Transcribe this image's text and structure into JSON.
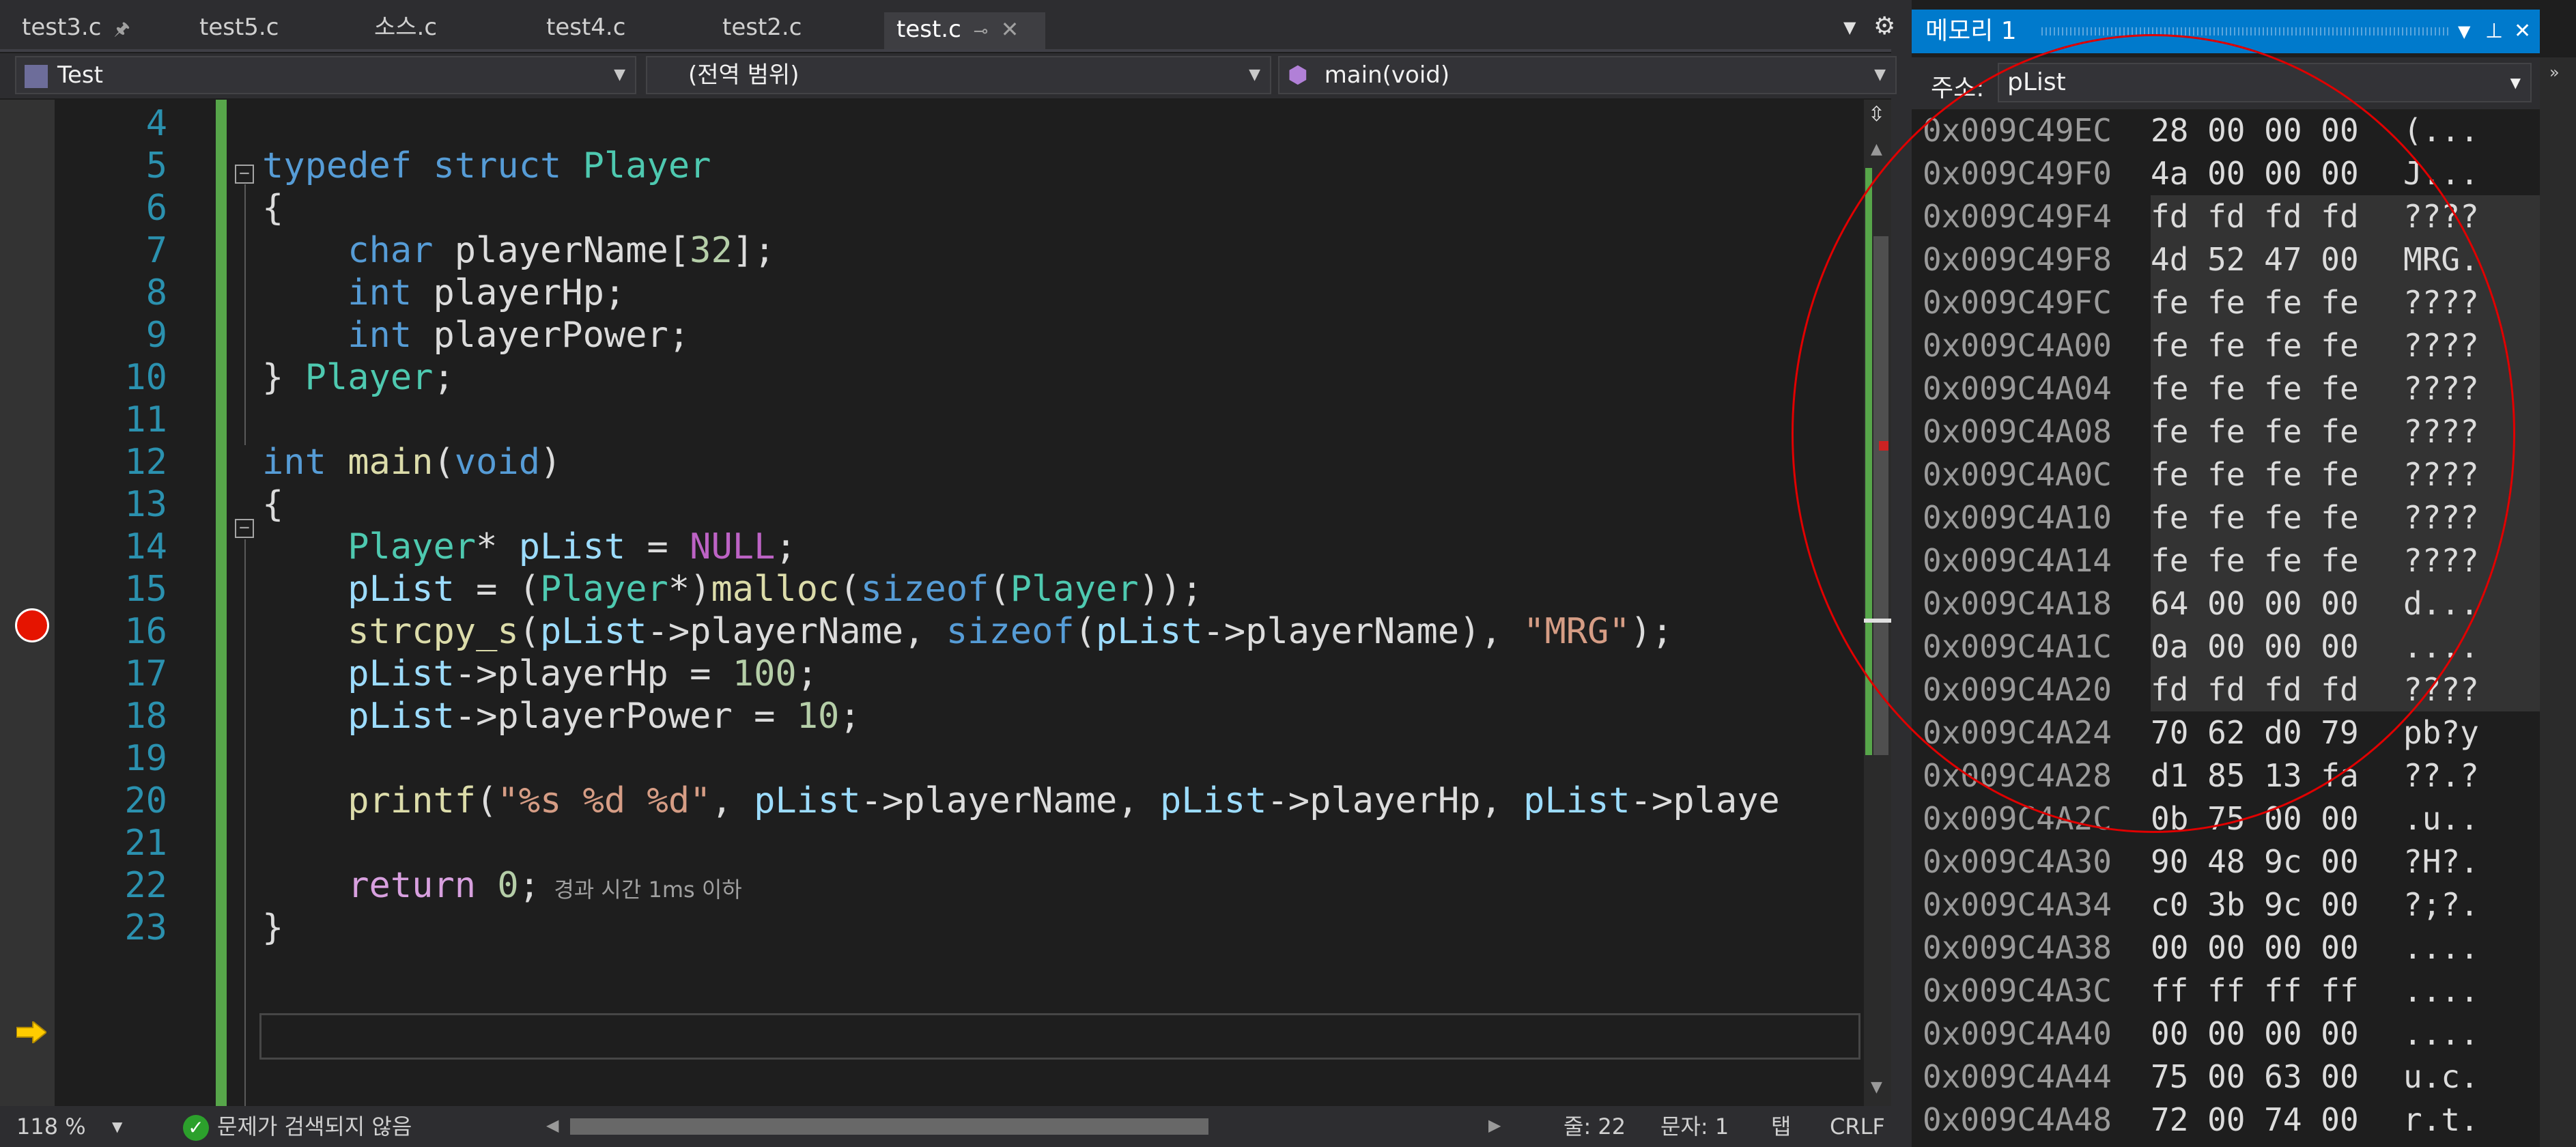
{
  "tabs": [
    {
      "label": "test3.c",
      "pin": "🖈"
    },
    {
      "label": "test5.c"
    },
    {
      "label": "소스.c"
    },
    {
      "label": "test4.c"
    },
    {
      "label": "test2.c"
    },
    {
      "label": "test.c",
      "active": true
    }
  ],
  "nav": {
    "project": "Test",
    "scope": "(전역 범위)",
    "function": "main(void)"
  },
  "code_lines": [
    {
      "num": "4",
      "text": ""
    },
    {
      "num": "5",
      "text": "typedef struct Player"
    },
    {
      "num": "6",
      "text": "{"
    },
    {
      "num": "7",
      "text": "    char playerName[32];"
    },
    {
      "num": "8",
      "text": "    int playerHp;"
    },
    {
      "num": "9",
      "text": "    int playerPower;"
    },
    {
      "num": "10",
      "text": "} Player;"
    },
    {
      "num": "11",
      "text": ""
    },
    {
      "num": "12",
      "text": "int main(void)"
    },
    {
      "num": "13",
      "text": "{"
    },
    {
      "num": "14",
      "text": "    Player* pList = NULL;"
    },
    {
      "num": "15",
      "text": "    pList = (Player*)malloc(sizeof(Player));"
    },
    {
      "num": "16",
      "text": "    strcpy_s(pList->playerName, sizeof(pList->playerName), \"MRG\");"
    },
    {
      "num": "17",
      "text": "    pList->playerHp = 100;"
    },
    {
      "num": "18",
      "text": "    pList->playerPower = 10;"
    },
    {
      "num": "19",
      "text": ""
    },
    {
      "num": "20",
      "text": "    printf(\"%s %d %d\", pList->playerName, pList->playerHp, pList->playe"
    },
    {
      "num": "21",
      "text": ""
    },
    {
      "num": "22",
      "text": "    return 0;"
    },
    {
      "num": "23",
      "text": "}"
    }
  ],
  "elapsed_hint": "경과 시간 1ms 이하",
  "status": {
    "zoom": "118 %",
    "issues": "문제가 검색되지 않음",
    "line": "줄: 22",
    "col": "문자: 1",
    "tab": "탭",
    "eol": "CRLF"
  },
  "memory": {
    "title": "메모리 1",
    "address_label": "주소:",
    "address_value": "pList",
    "rows": [
      {
        "addr": "0x009C49EC",
        "hex": "28 00 00 00",
        "text": "(..."
      },
      {
        "addr": "0x009C49F0",
        "hex": "4a 00 00 00",
        "text": "J..."
      },
      {
        "addr": "0x009C49F4",
        "hex": "fd fd fd fd",
        "text": "????",
        "hl": true
      },
      {
        "addr": "0x009C49F8",
        "hex": "4d 52 47 00",
        "text": "MRG.",
        "hl": true
      },
      {
        "addr": "0x009C49FC",
        "hex": "fe fe fe fe",
        "text": "????",
        "hl": true
      },
      {
        "addr": "0x009C4A00",
        "hex": "fe fe fe fe",
        "text": "????",
        "hl": true
      },
      {
        "addr": "0x009C4A04",
        "hex": "fe fe fe fe",
        "text": "????",
        "hl": true
      },
      {
        "addr": "0x009C4A08",
        "hex": "fe fe fe fe",
        "text": "????",
        "hl": true
      },
      {
        "addr": "0x009C4A0C",
        "hex": "fe fe fe fe",
        "text": "????",
        "hl": true
      },
      {
        "addr": "0x009C4A10",
        "hex": "fe fe fe fe",
        "text": "????",
        "hl": true
      },
      {
        "addr": "0x009C4A14",
        "hex": "fe fe fe fe",
        "text": "????",
        "hl": true
      },
      {
        "addr": "0x009C4A18",
        "hex": "64 00 00 00",
        "text": "d...",
        "hl": true
      },
      {
        "addr": "0x009C4A1C",
        "hex": "0a 00 00 00",
        "text": "....",
        "hl": true
      },
      {
        "addr": "0x009C4A20",
        "hex": "fd fd fd fd",
        "text": "????",
        "hl": true
      },
      {
        "addr": "0x009C4A24",
        "hex": "70 62 d0 79",
        "text": "pb?y"
      },
      {
        "addr": "0x009C4A28",
        "hex": "d1 85 13 fa",
        "text": "??.?"
      },
      {
        "addr": "0x009C4A2C",
        "hex": "0b 75 00 00",
        "text": ".u.."
      },
      {
        "addr": "0x009C4A30",
        "hex": "90 48 9c 00",
        "text": "?H?."
      },
      {
        "addr": "0x009C4A34",
        "hex": "c0 3b 9c 00",
        "text": "?;?."
      },
      {
        "addr": "0x009C4A38",
        "hex": "00 00 00 00",
        "text": "...."
      },
      {
        "addr": "0x009C4A3C",
        "hex": "ff ff ff ff",
        "text": "...."
      },
      {
        "addr": "0x009C4A40",
        "hex": "00 00 00 00",
        "text": "...."
      },
      {
        "addr": "0x009C4A44",
        "hex": "75 00 63 00",
        "text": "u.c."
      },
      {
        "addr": "0x009C4A48",
        "hex": "72 00 74 00",
        "text": "r.t."
      }
    ]
  },
  "colors": {
    "accent": "#007acc",
    "breakpoint": "#e51400",
    "annotation_circle": "#e00000",
    "change_bar": "#57a64a"
  },
  "icons": [
    "pin-icon",
    "close-icon",
    "dropdown-arrow-icon",
    "breakpoint-icon",
    "current-statement-arrow-icon",
    "check-circle-icon",
    "split-editor-icon",
    "cube-icon"
  ]
}
